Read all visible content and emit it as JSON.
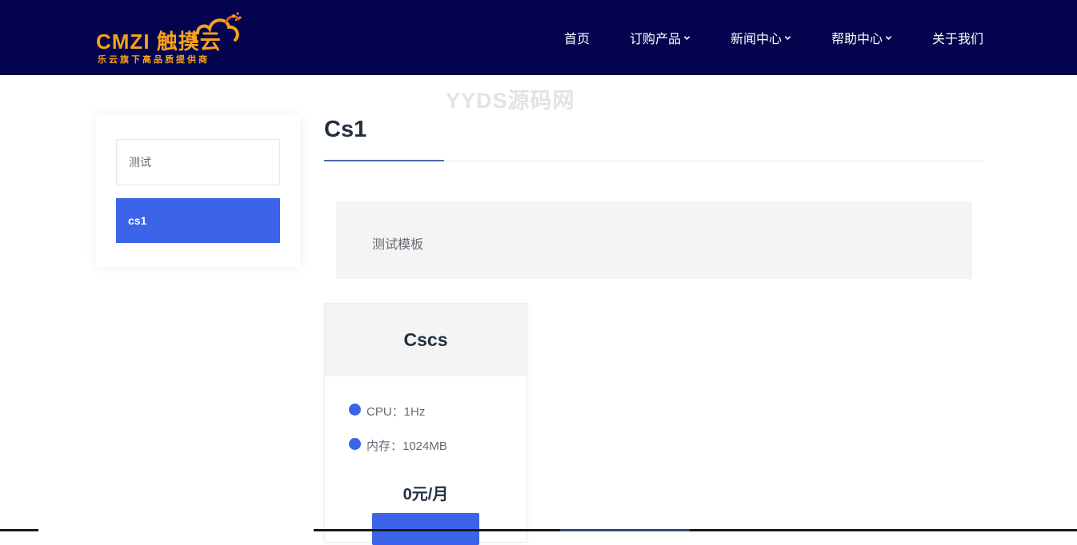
{
  "header": {
    "logo_text": "CMZI 触摸云",
    "logo_tagline": "乐云旗下高品质提供商",
    "nav": [
      {
        "label": "首页",
        "has_dropdown": false
      },
      {
        "label": "订购产品",
        "has_dropdown": true
      },
      {
        "label": "新闻中心",
        "has_dropdown": true
      },
      {
        "label": "帮助中心",
        "has_dropdown": true
      },
      {
        "label": "关于我们",
        "has_dropdown": false
      }
    ]
  },
  "watermark": "YYDS源码网",
  "sidebar": {
    "items": [
      {
        "label": "测试",
        "active": false
      },
      {
        "label": "cs1",
        "active": true
      }
    ]
  },
  "main": {
    "title": "Cs1",
    "description": "测试模板"
  },
  "product": {
    "name": "Cscs",
    "specs": [
      {
        "text": "CPU：1Hz"
      },
      {
        "text": "内存：1024MB"
      }
    ],
    "price": "0元/月"
  },
  "colors": {
    "header_bg": "#04034d",
    "accent": "#3c64e8",
    "logo": "#f7a21a",
    "title_text": "#22303f",
    "body_text": "#666a75"
  }
}
